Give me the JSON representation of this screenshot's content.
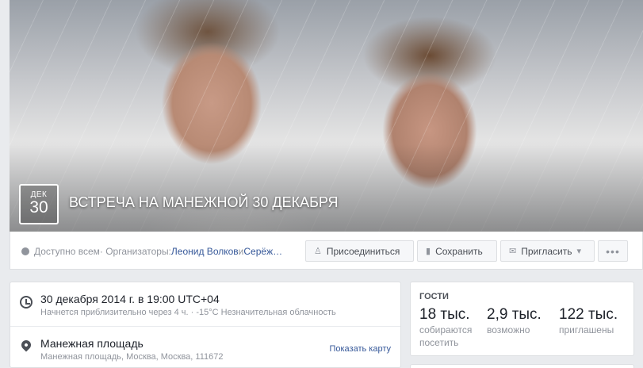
{
  "cover": {
    "date_month": "ДЕК",
    "date_day": "30",
    "title": "ВСТРЕЧА НА МАНЕЖНОЙ 30 ДЕКАБРЯ"
  },
  "info": {
    "privacy": "Доступно всем",
    "separator": " · Организаторы: ",
    "organizer_1": "Леонид Волков",
    "and": " и ",
    "organizer_2": "Серёж…"
  },
  "actions": {
    "join_label": "Присоединиться",
    "save_label": "Сохранить",
    "invite_label": "Пригласить",
    "more_label": "•••"
  },
  "details": {
    "time_main": "30 декабря 2014 г. в 19:00 UTC+04",
    "time_sub": "Начнется приблизительно через 4 ч. · -15°C Незначительная облачность",
    "place_main": "Манежная площадь",
    "place_sub": "Манежная площадь, Москва, Москва, 111672",
    "map_link": "Показать карту"
  },
  "guests": {
    "title": "ГОСТИ",
    "going_count": "18 тыс.",
    "going_label_1": "собираются",
    "going_label_2": "посетить",
    "maybe_count": "2,9 тыс.",
    "maybe_label": "возможно",
    "invited_count": "122 тыс.",
    "invited_label": "приглашены"
  },
  "colors": {
    "link": "#365899",
    "muted": "#90949c",
    "background": "#e9ebee"
  }
}
